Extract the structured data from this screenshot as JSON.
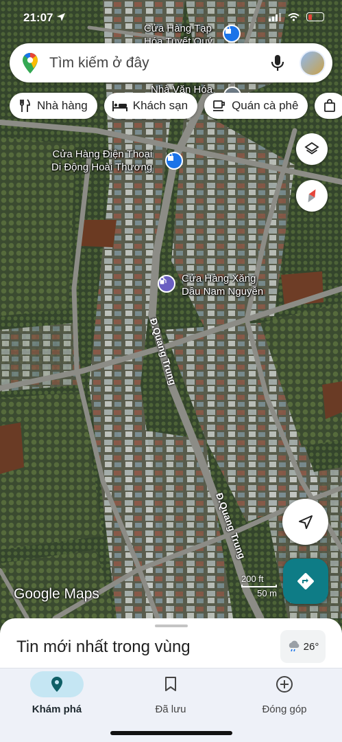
{
  "status_bar": {
    "time": "21:07"
  },
  "search": {
    "placeholder": "Tìm kiếm ở đây"
  },
  "chips": [
    {
      "label": "Nhà hàng",
      "icon": "restaurant-icon"
    },
    {
      "label": "Khách sạn",
      "icon": "hotel-icon"
    },
    {
      "label": "Quán cà phê",
      "icon": "coffee-icon"
    },
    {
      "label": "",
      "icon": "shopping-bag-icon"
    }
  ],
  "map": {
    "places": [
      {
        "name_line1": "Cửa Hàng Tạp",
        "name_line2": "Hóa Tuyết Quý",
        "icon": "shopping-bag-icon"
      },
      {
        "name_line1": "Nhà Văn Hóa",
        "name_line2": "",
        "icon": "landmark-icon"
      },
      {
        "name_line1": "Cửa Hàng Điện Thoại",
        "name_line2": "Di Động Hoài Thương",
        "icon": "shopping-bag-icon"
      },
      {
        "name_line1": "Cửa Hàng Xăng",
        "name_line2": "Dầu Nam Nguyễn",
        "icon": "gas-station-icon"
      }
    ],
    "roads": [
      "Đ.Quang Trung",
      "Đ.Quang Trung"
    ],
    "attribution": "Google Maps",
    "scale": {
      "ft": "200 ft",
      "m": "50 m"
    }
  },
  "sheet": {
    "title": "Tin mới nhất trong vùng",
    "weather": "26°"
  },
  "nav": [
    {
      "label": "Khám phá",
      "icon": "location-pin-icon",
      "active": true
    },
    {
      "label": "Đã lưu",
      "icon": "bookmark-icon",
      "active": false
    },
    {
      "label": "Đóng góp",
      "icon": "add-circle-icon",
      "active": false
    }
  ],
  "colors": {
    "accent": "#0e7c86",
    "nav_active": "#c5e6f3",
    "poi_blue": "#1a73e8",
    "gas_purple": "#6a5fc1"
  }
}
